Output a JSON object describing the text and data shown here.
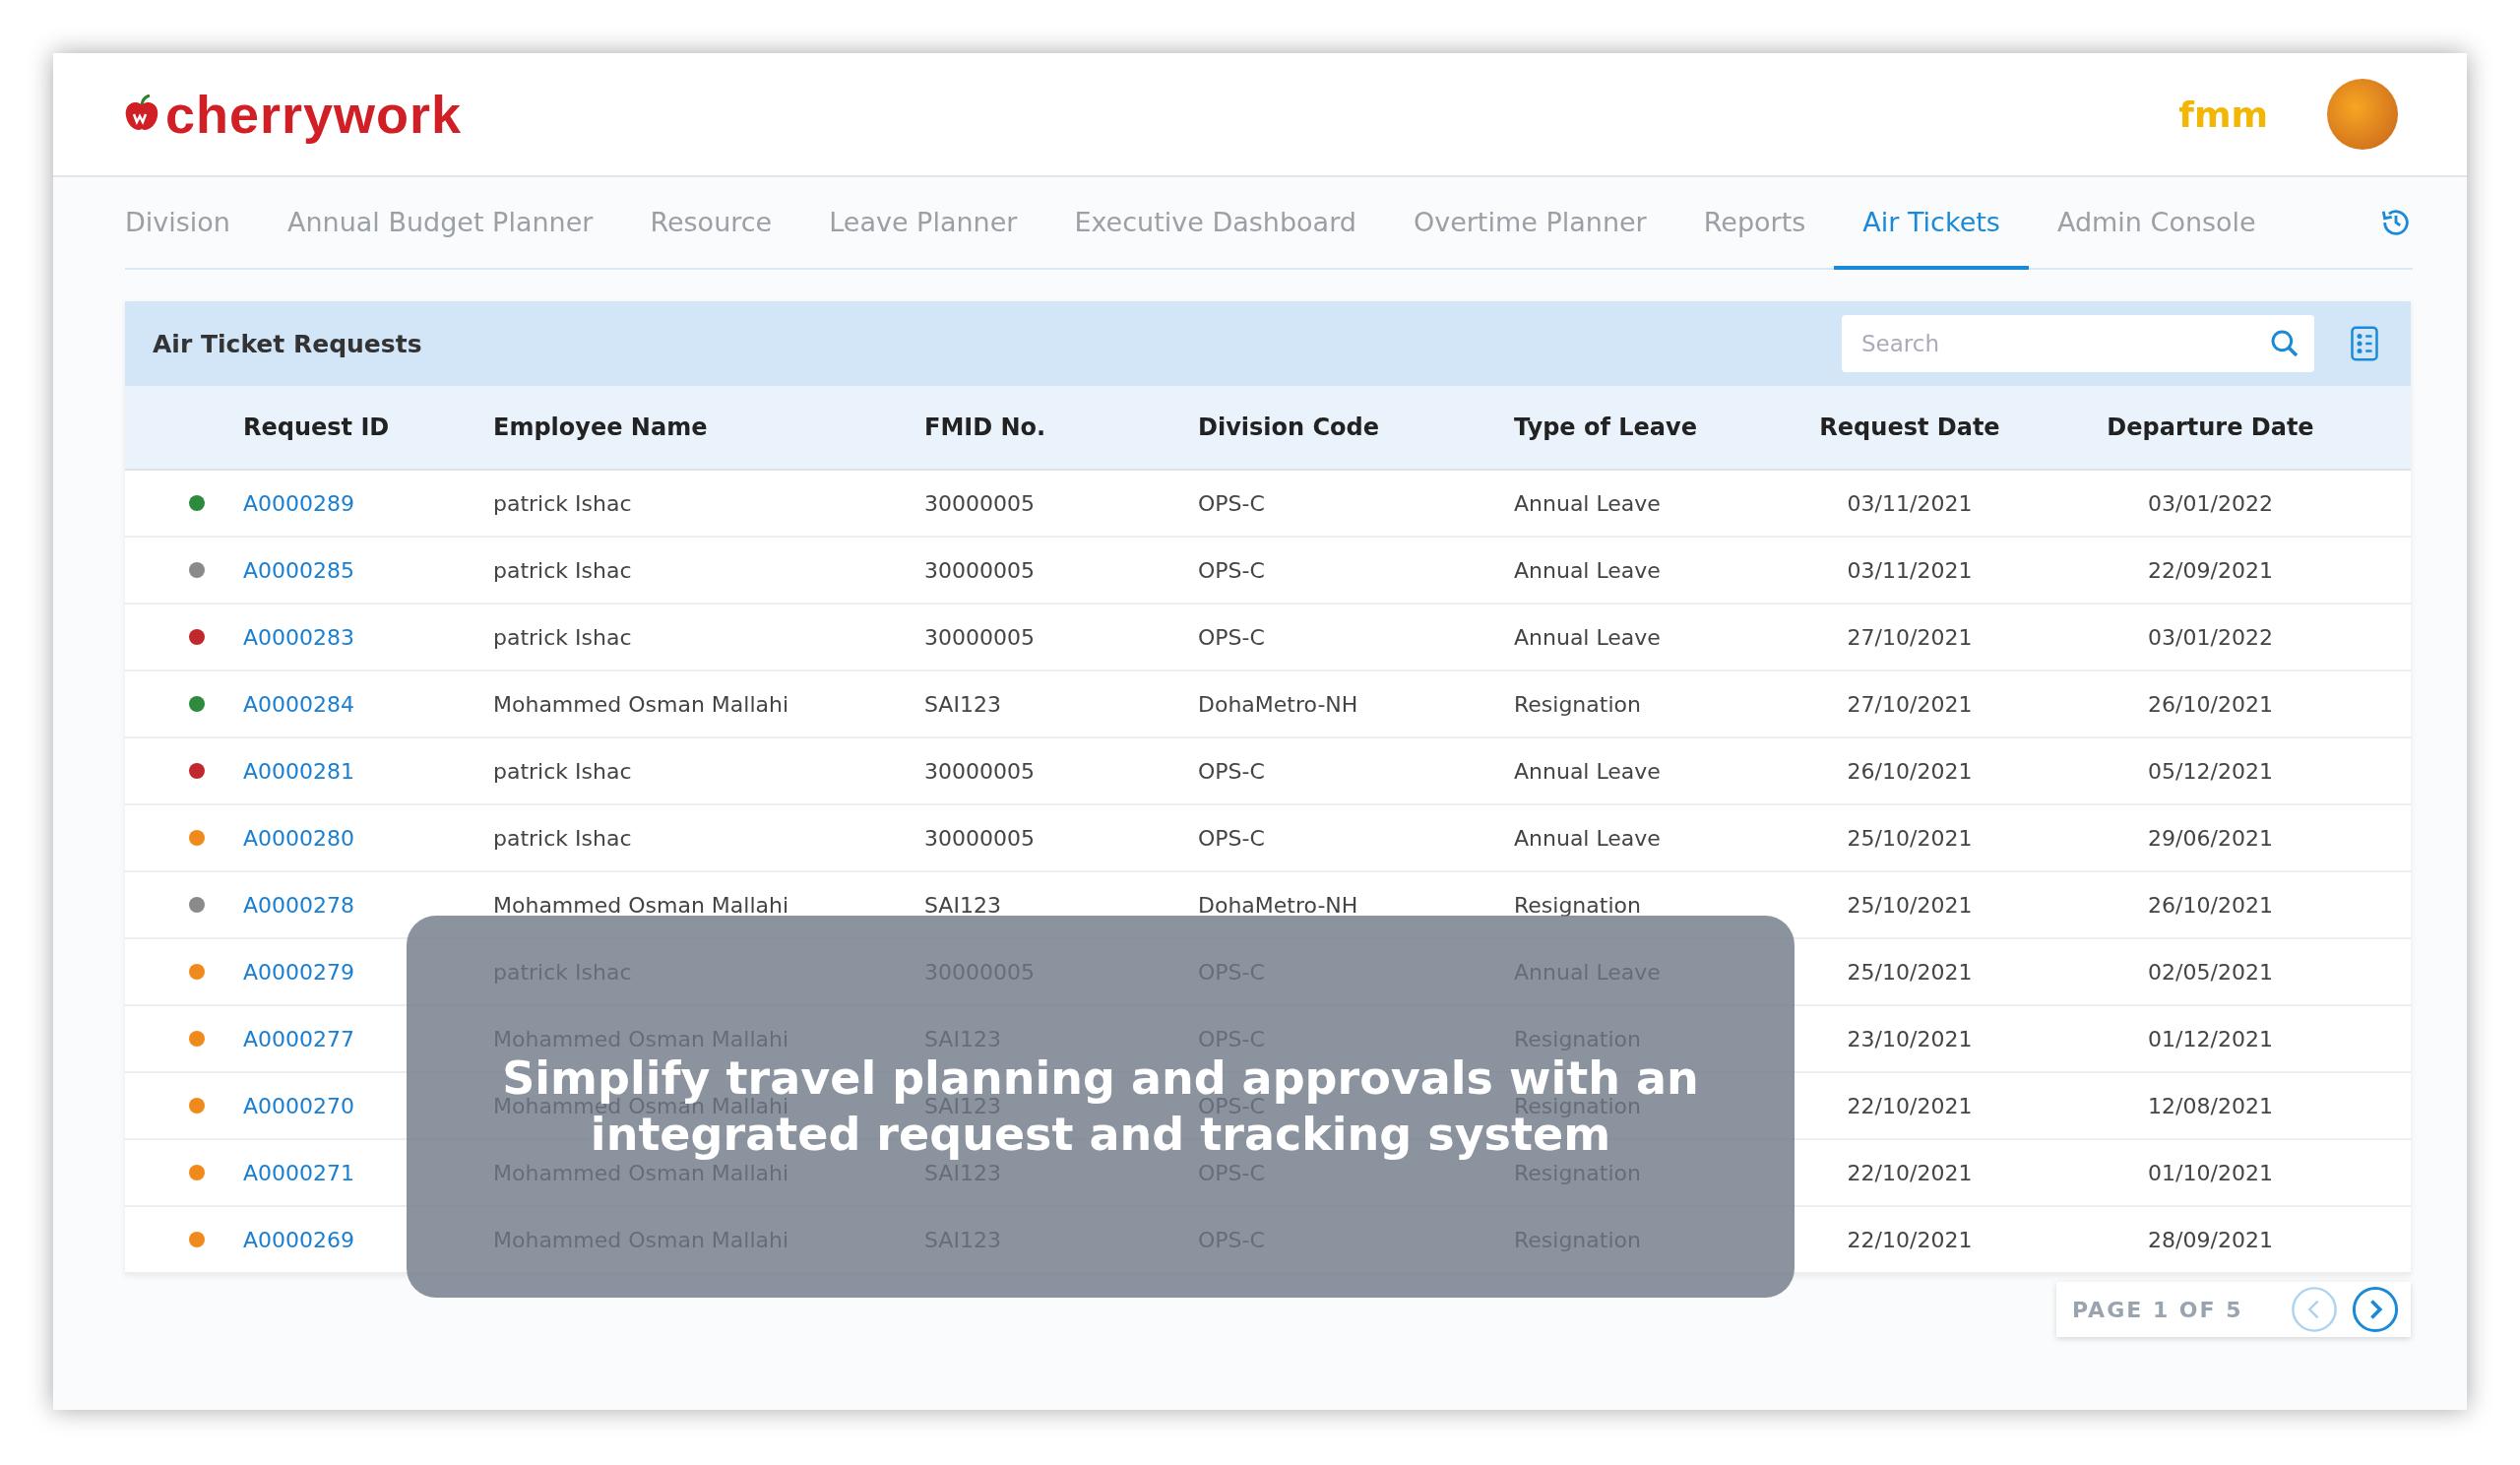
{
  "header": {
    "logo_text": "cherrywork",
    "partner_logo_text": "fmm"
  },
  "nav": {
    "tabs": [
      {
        "label": "Division",
        "selected": false
      },
      {
        "label": "Annual Budget Planner",
        "selected": false
      },
      {
        "label": "Resource",
        "selected": false
      },
      {
        "label": "Leave Planner",
        "selected": false
      },
      {
        "label": "Executive Dashboard",
        "selected": false
      },
      {
        "label": "Overtime Planner",
        "selected": false
      },
      {
        "label": "Reports",
        "selected": false
      },
      {
        "label": "Air Tickets",
        "selected": true
      },
      {
        "label": "Admin Console",
        "selected": false
      }
    ]
  },
  "panel": {
    "title": "Air Ticket Requests",
    "search": {
      "placeholder": "Search"
    }
  },
  "table": {
    "columns": [
      "Request ID",
      "Employee Name",
      "FMID No.",
      "Division Code",
      "Type of Leave",
      "Request Date",
      "Departure Date"
    ],
    "rows": [
      {
        "color": "#2e8b3e",
        "cells": [
          "A0000289",
          "patrick Ishac",
          "30000005",
          "OPS-C",
          "Annual Leave",
          "03/11/2021",
          "03/01/2022"
        ]
      },
      {
        "color": "#8a8a8a",
        "cells": [
          "A0000285",
          "patrick Ishac",
          "30000005",
          "OPS-C",
          "Annual Leave",
          "03/11/2021",
          "22/09/2021"
        ]
      },
      {
        "color": "#c0282d",
        "cells": [
          "A0000283",
          "patrick Ishac",
          "30000005",
          "OPS-C",
          "Annual Leave",
          "27/10/2021",
          "03/01/2022"
        ]
      },
      {
        "color": "#2e8b3e",
        "cells": [
          "A0000284",
          "Mohammed Osman Mallahi",
          "SAI123",
          "DohaMetro-NH",
          "Resignation",
          "27/10/2021",
          "26/10/2021"
        ]
      },
      {
        "color": "#c0282d",
        "cells": [
          "A0000281",
          "patrick Ishac",
          "30000005",
          "OPS-C",
          "Annual Leave",
          "26/10/2021",
          "05/12/2021"
        ]
      },
      {
        "color": "#f08a1c",
        "cells": [
          "A0000280",
          "patrick Ishac",
          "30000005",
          "OPS-C",
          "Annual Leave",
          "25/10/2021",
          "29/06/2021"
        ]
      },
      {
        "color": "#8a8a8a",
        "cells": [
          "A0000278",
          "Mohammed Osman Mallahi",
          "SAI123",
          "DohaMetro-NH",
          "Resignation",
          "25/10/2021",
          "26/10/2021"
        ]
      },
      {
        "color": "#f08a1c",
        "cells": [
          "A0000279",
          "patrick Ishac",
          "30000005",
          "OPS-C",
          "Annual Leave",
          "25/10/2021",
          "02/05/2021"
        ]
      },
      {
        "color": "#f08a1c",
        "cells": [
          "A0000277",
          "Mohammed Osman Mallahi",
          "SAI123",
          "OPS-C",
          "Resignation",
          "23/10/2021",
          "01/12/2021"
        ]
      },
      {
        "color": "#f08a1c",
        "cells": [
          "A0000270",
          "Mohammed Osman Mallahi",
          "SAI123",
          "OPS-C",
          "Resignation",
          "22/10/2021",
          "12/08/2021"
        ]
      },
      {
        "color": "#f08a1c",
        "cells": [
          "A0000271",
          "Mohammed Osman Mallahi",
          "SAI123",
          "OPS-C",
          "Resignation",
          "22/10/2021",
          "01/10/2021"
        ]
      },
      {
        "color": "#f08a1c",
        "cells": [
          "A0000269",
          "Mohammed Osman Mallahi",
          "SAI123",
          "OPS-C",
          "Resignation",
          "22/10/2021",
          "28/09/2021"
        ]
      }
    ]
  },
  "pagination": {
    "label": "PAGE 1 OF 5"
  },
  "caption": "Simplify travel planning and approvals with an integrated request and tracking system"
}
